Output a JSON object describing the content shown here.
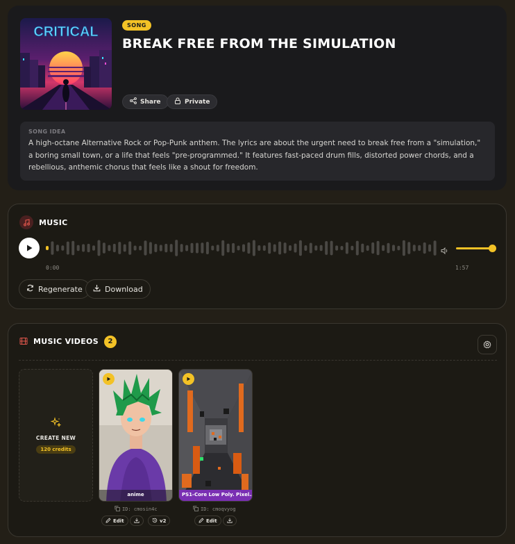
{
  "song": {
    "badge": "SONG",
    "title": "BREAK FREE FROM THE SIMULATION",
    "cover_text": "CRITICAL",
    "share_label": "Share",
    "private_label": "Private",
    "idea_label": "SONG IDEA",
    "idea_text": "A high-octane Alternative Rock or Pop-Punk anthem. The lyrics are about the urgent need to break free from a \"simulation,\" a boring small town, or a life that feels \"pre-programmed.\" It features fast-paced drum fills, distorted power chords, and a rebellious, anthemic chorus that feels like a shout for freedom."
  },
  "music": {
    "section_title": "MUSIC",
    "time_start": "0:00",
    "time_end": "1:57",
    "progress": 0.0,
    "volume": 1.0,
    "regenerate_label": "Regenerate",
    "download_label": "Download"
  },
  "videos": {
    "section_title": "MUSIC VIDEOS",
    "count": "2",
    "create_new_label": "CREATE NEW",
    "create_new_credits": "120 credits",
    "items": [
      {
        "caption": "anime",
        "id": "ID: cmosin4c",
        "edit_label": "Edit",
        "version": "v2"
      },
      {
        "caption": "PS1-Core Low Poly. Pixel...",
        "id": "ID: cmoqvyog",
        "edit_label": "Edit"
      }
    ]
  },
  "colors": {
    "accent": "#f3c226",
    "background": "#231f17",
    "card": "#1a1a1c"
  },
  "icons": [
    "share-icon",
    "lock-icon",
    "music-note-icon",
    "play-icon",
    "volume-icon",
    "refresh-icon",
    "download-icon",
    "film-icon",
    "gear-icon",
    "sparkle-icon",
    "copy-icon",
    "pencil-icon",
    "history-icon"
  ]
}
